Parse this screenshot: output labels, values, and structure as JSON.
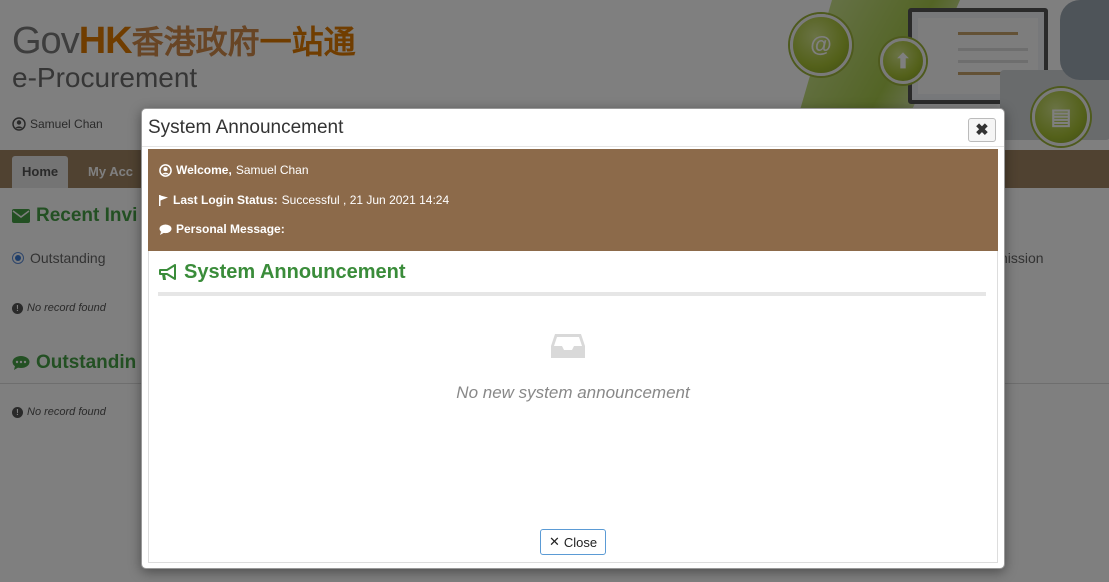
{
  "header": {
    "brand_gov": "Gov",
    "brand_hk": "HK",
    "brand_cn_normal": "香港政府",
    "brand_cn_strong": "一站通",
    "subtitle": "e-Procurement",
    "user_name": "Samuel Chan"
  },
  "tabs": [
    {
      "label": "Home"
    },
    {
      "label": "My Acc"
    }
  ],
  "background": {
    "recent_section": "Recent Invi",
    "filter_outstanding": "Outstanding",
    "right_partial": "nission",
    "no_record_1": "No record found",
    "outstanding_section": "Outstandin",
    "no_record_2": "No record found"
  },
  "modal": {
    "title": "System Announcement",
    "welcome_label": "Welcome,",
    "welcome_name": "Samuel Chan",
    "last_login_label": "Last Login Status:",
    "last_login_value": "Successful , 21 Jun 2021 14:24",
    "personal_message_label": "Personal Message:",
    "announcement_heading": "System Announcement",
    "empty_message": "No new system announcement",
    "close_label": "Close"
  },
  "colors": {
    "tab_bar": "#a08563",
    "welcome_box": "#8c6a4a",
    "section_green": "#46a146",
    "accent_blue": "#5b9bd5"
  },
  "icons": {
    "user": "user-circle-icon",
    "flag": "flag-icon",
    "comment": "comment-icon",
    "bullhorn": "bullhorn-icon",
    "inbox": "inbox-icon",
    "close": "close-icon",
    "envelope": "envelope-icon",
    "info": "info-icon"
  }
}
